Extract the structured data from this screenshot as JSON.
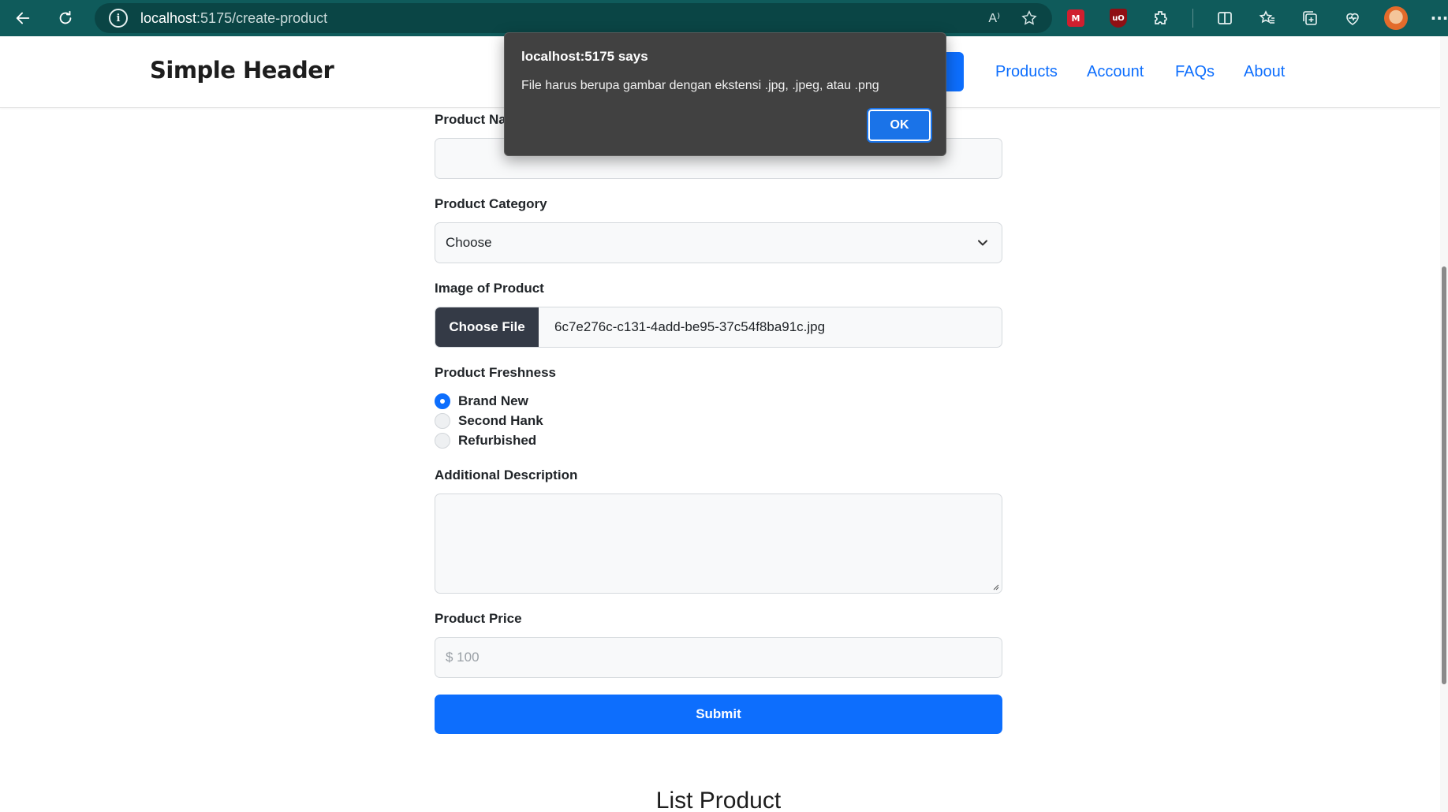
{
  "browser": {
    "url_host": "localhost",
    "url_path": ":5175/create-product",
    "read_aloud_label": "A⁾"
  },
  "header": {
    "brand": "Simple Header",
    "nav": [
      {
        "label": "Products"
      },
      {
        "label": "Account"
      },
      {
        "label": "FAQs"
      },
      {
        "label": "About"
      }
    ],
    "accent_color": "#0d6efd"
  },
  "form": {
    "product_name_label": "Product Name",
    "product_category_label": "Product Category",
    "product_category_value": "Choose",
    "image_label": "Image of Product",
    "choose_file_label": "Choose File",
    "file_name": "6c7e276c-c131-4add-be95-37c54f8ba91c.jpg",
    "freshness_label": "Product Freshness",
    "freshness_options": [
      {
        "label": "Brand New",
        "checked": true
      },
      {
        "label": "Second Hank",
        "checked": false
      },
      {
        "label": "Refurbished",
        "checked": false
      }
    ],
    "description_label": "Additional Description",
    "price_label": "Product Price",
    "price_placeholder": "$ 100",
    "submit_label": "Submit"
  },
  "list": {
    "title": "List Product"
  },
  "dialog": {
    "title": "localhost:5175 says",
    "message": "File harus berupa gambar dengan ekstensi .jpg, .jpeg, atau .png",
    "ok_label": "OK"
  },
  "icons": {
    "back": "back-arrow-icon",
    "refresh": "refresh-icon",
    "info": "info-icon",
    "favorite": "star-icon",
    "split": "split-screen-icon",
    "favorites": "favorites-icon",
    "collections": "collections-icon",
    "health": "browser-essentials-icon",
    "more": "more-icon"
  }
}
